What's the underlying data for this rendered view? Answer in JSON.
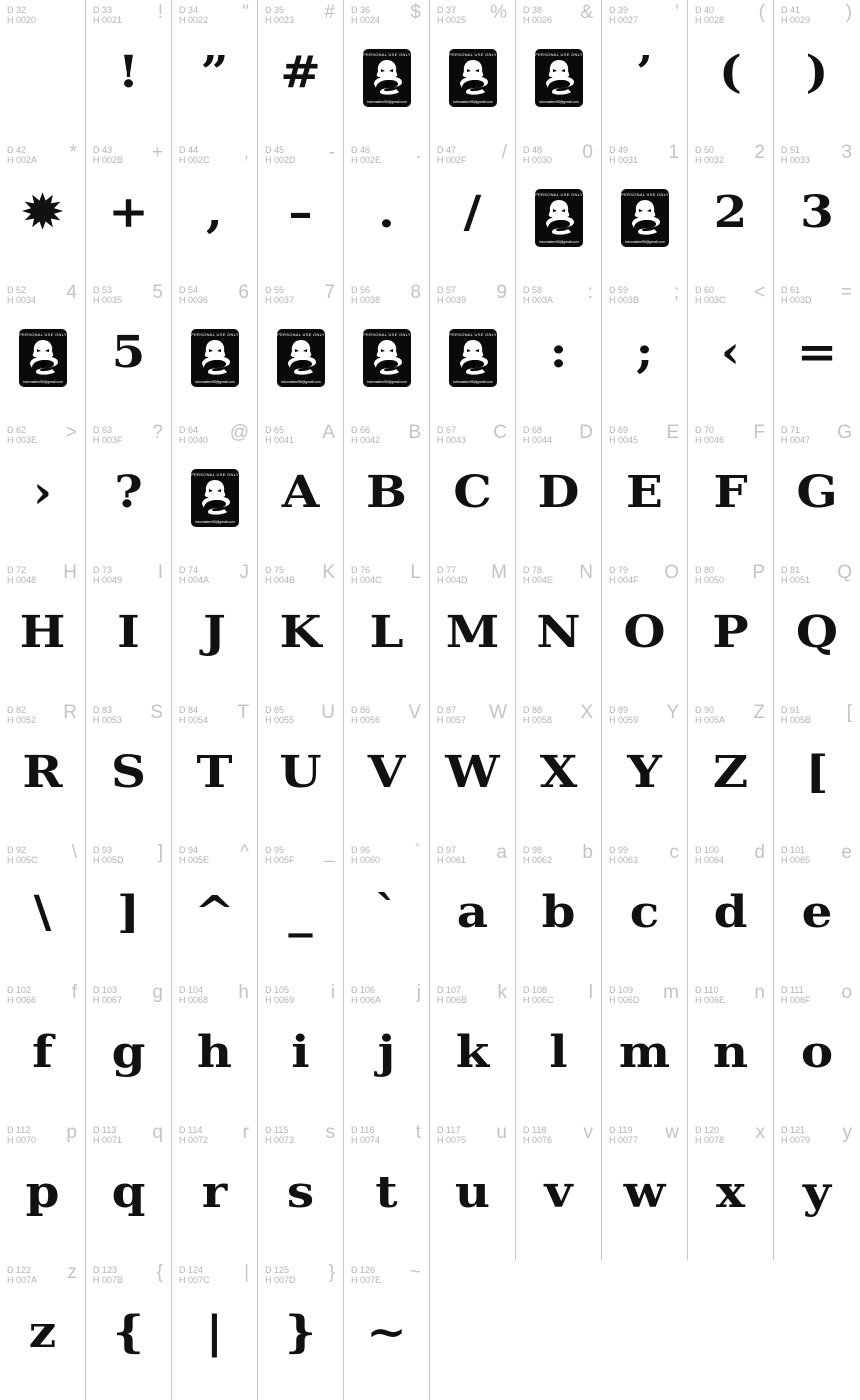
{
  "columns": 10,
  "logo": {
    "top_text": "PERSONAL USE ONLY",
    "bottom_text": "totomaiden98@gmail.com"
  },
  "cells": [
    {
      "d": "D 32",
      "h": "H 0020",
      "ref": "",
      "glyph": "",
      "logo": false
    },
    {
      "d": "D 33",
      "h": "H 0021",
      "ref": "!",
      "glyph": "!",
      "logo": false
    },
    {
      "d": "D 34",
      "h": "H 0022",
      "ref": "\"",
      "glyph": "”",
      "logo": false
    },
    {
      "d": "D 35",
      "h": "H 0023",
      "ref": "#",
      "glyph": "#",
      "logo": false
    },
    {
      "d": "D 36",
      "h": "H 0024",
      "ref": "$",
      "glyph": "",
      "logo": true
    },
    {
      "d": "D 37",
      "h": "H 0025",
      "ref": "%",
      "glyph": "",
      "logo": true
    },
    {
      "d": "D 38",
      "h": "H 0026",
      "ref": "&",
      "glyph": "",
      "logo": true
    },
    {
      "d": "D 39",
      "h": "H 0027",
      "ref": "'",
      "glyph": "’",
      "logo": false
    },
    {
      "d": "D 40",
      "h": "H 0028",
      "ref": "(",
      "glyph": "(",
      "logo": false
    },
    {
      "d": "D 41",
      "h": "H 0029",
      "ref": ")",
      "glyph": ")",
      "logo": false
    },
    {
      "d": "D 42",
      "h": "H 002A",
      "ref": "*",
      "glyph": "✹",
      "logo": false
    },
    {
      "d": "D 43",
      "h": "H 002B",
      "ref": "+",
      "glyph": "+",
      "logo": false
    },
    {
      "d": "D 44",
      "h": "H 002C",
      "ref": ",",
      "glyph": ",",
      "logo": false
    },
    {
      "d": "D 45",
      "h": "H 002D",
      "ref": "-",
      "glyph": "–",
      "logo": false
    },
    {
      "d": "D 46",
      "h": "H 002E",
      "ref": ".",
      "glyph": ".",
      "logo": false
    },
    {
      "d": "D 47",
      "h": "H 002F",
      "ref": "/",
      "glyph": "/",
      "logo": false
    },
    {
      "d": "D 48",
      "h": "H 0030",
      "ref": "0",
      "glyph": "",
      "logo": true
    },
    {
      "d": "D 49",
      "h": "H 0031",
      "ref": "1",
      "glyph": "",
      "logo": true
    },
    {
      "d": "D 50",
      "h": "H 0032",
      "ref": "2",
      "glyph": "2",
      "logo": false
    },
    {
      "d": "D 51",
      "h": "H 0033",
      "ref": "3",
      "glyph": "3",
      "logo": false
    },
    {
      "d": "D 52",
      "h": "H 0034",
      "ref": "4",
      "glyph": "",
      "logo": true
    },
    {
      "d": "D 53",
      "h": "H 0035",
      "ref": "5",
      "glyph": "5",
      "logo": false
    },
    {
      "d": "D 54",
      "h": "H 0036",
      "ref": "6",
      "glyph": "",
      "logo": true
    },
    {
      "d": "D 55",
      "h": "H 0037",
      "ref": "7",
      "glyph": "",
      "logo": true
    },
    {
      "d": "D 56",
      "h": "H 0038",
      "ref": "8",
      "glyph": "",
      "logo": true
    },
    {
      "d": "D 57",
      "h": "H 0039",
      "ref": "9",
      "glyph": "",
      "logo": true
    },
    {
      "d": "D 58",
      "h": "H 003A",
      "ref": ":",
      "glyph": ":",
      "logo": false
    },
    {
      "d": "D 59",
      "h": "H 003B",
      "ref": ";",
      "glyph": ";",
      "logo": false
    },
    {
      "d": "D 60",
      "h": "H 003C",
      "ref": "<",
      "glyph": "‹",
      "logo": false
    },
    {
      "d": "D 61",
      "h": "H 003D",
      "ref": "=",
      "glyph": "=",
      "logo": false
    },
    {
      "d": "D 62",
      "h": "H 003E",
      "ref": ">",
      "glyph": "›",
      "logo": false
    },
    {
      "d": "D 63",
      "h": "H 003F",
      "ref": "?",
      "glyph": "?",
      "logo": false
    },
    {
      "d": "D 64",
      "h": "H 0040",
      "ref": "@",
      "glyph": "",
      "logo": true
    },
    {
      "d": "D 65",
      "h": "H 0041",
      "ref": "A",
      "glyph": "A",
      "logo": false
    },
    {
      "d": "D 66",
      "h": "H 0042",
      "ref": "B",
      "glyph": "B",
      "logo": false
    },
    {
      "d": "D 67",
      "h": "H 0043",
      "ref": "C",
      "glyph": "C",
      "logo": false
    },
    {
      "d": "D 68",
      "h": "H 0044",
      "ref": "D",
      "glyph": "D",
      "logo": false
    },
    {
      "d": "D 69",
      "h": "H 0045",
      "ref": "E",
      "glyph": "E",
      "logo": false
    },
    {
      "d": "D 70",
      "h": "H 0046",
      "ref": "F",
      "glyph": "F",
      "logo": false
    },
    {
      "d": "D 71",
      "h": "H 0047",
      "ref": "G",
      "glyph": "G",
      "logo": false
    },
    {
      "d": "D 72",
      "h": "H 0048",
      "ref": "H",
      "glyph": "H",
      "logo": false
    },
    {
      "d": "D 73",
      "h": "H 0049",
      "ref": "I",
      "glyph": "I",
      "logo": false
    },
    {
      "d": "D 74",
      "h": "H 004A",
      "ref": "J",
      "glyph": "J",
      "logo": false
    },
    {
      "d": "D 75",
      "h": "H 004B",
      "ref": "K",
      "glyph": "K",
      "logo": false
    },
    {
      "d": "D 76",
      "h": "H 004C",
      "ref": "L",
      "glyph": "L",
      "logo": false
    },
    {
      "d": "D 77",
      "h": "H 004D",
      "ref": "M",
      "glyph": "M",
      "logo": false
    },
    {
      "d": "D 78",
      "h": "H 004E",
      "ref": "N",
      "glyph": "N",
      "logo": false
    },
    {
      "d": "D 79",
      "h": "H 004F",
      "ref": "O",
      "glyph": "O",
      "logo": false
    },
    {
      "d": "D 80",
      "h": "H 0050",
      "ref": "P",
      "glyph": "P",
      "logo": false
    },
    {
      "d": "D 81",
      "h": "H 0051",
      "ref": "Q",
      "glyph": "Q",
      "logo": false
    },
    {
      "d": "D 82",
      "h": "H 0052",
      "ref": "R",
      "glyph": "R",
      "logo": false
    },
    {
      "d": "D 83",
      "h": "H 0053",
      "ref": "S",
      "glyph": "S",
      "logo": false
    },
    {
      "d": "D 84",
      "h": "H 0054",
      "ref": "T",
      "glyph": "T",
      "logo": false
    },
    {
      "d": "D 85",
      "h": "H 0055",
      "ref": "U",
      "glyph": "U",
      "logo": false
    },
    {
      "d": "D 86",
      "h": "H 0056",
      "ref": "V",
      "glyph": "V",
      "logo": false
    },
    {
      "d": "D 87",
      "h": "H 0057",
      "ref": "W",
      "glyph": "W",
      "logo": false
    },
    {
      "d": "D 88",
      "h": "H 0058",
      "ref": "X",
      "glyph": "X",
      "logo": false
    },
    {
      "d": "D 89",
      "h": "H 0059",
      "ref": "Y",
      "glyph": "Y",
      "logo": false
    },
    {
      "d": "D 90",
      "h": "H 005A",
      "ref": "Z",
      "glyph": "Z",
      "logo": false
    },
    {
      "d": "D 91",
      "h": "H 005B",
      "ref": "[",
      "glyph": "[",
      "logo": false
    },
    {
      "d": "D 92",
      "h": "H 005C",
      "ref": "\\",
      "glyph": "\\",
      "logo": false
    },
    {
      "d": "D 93",
      "h": "H 005D",
      "ref": "]",
      "glyph": "]",
      "logo": false
    },
    {
      "d": "D 94",
      "h": "H 005E",
      "ref": "^",
      "glyph": "^",
      "logo": false
    },
    {
      "d": "D 95",
      "h": "H 005F",
      "ref": "_",
      "glyph": "_",
      "logo": false
    },
    {
      "d": "D 96",
      "h": "H 0060",
      "ref": "`",
      "glyph": "`",
      "logo": false
    },
    {
      "d": "D 97",
      "h": "H 0061",
      "ref": "a",
      "glyph": "a",
      "logo": false
    },
    {
      "d": "D 98",
      "h": "H 0062",
      "ref": "b",
      "glyph": "b",
      "logo": false
    },
    {
      "d": "D 99",
      "h": "H 0063",
      "ref": "c",
      "glyph": "c",
      "logo": false
    },
    {
      "d": "D 100",
      "h": "H 0064",
      "ref": "d",
      "glyph": "d",
      "logo": false
    },
    {
      "d": "D 101",
      "h": "H 0065",
      "ref": "e",
      "glyph": "e",
      "logo": false
    },
    {
      "d": "D 102",
      "h": "H 0066",
      "ref": "f",
      "glyph": "f",
      "logo": false
    },
    {
      "d": "D 103",
      "h": "H 0067",
      "ref": "g",
      "glyph": "g",
      "logo": false
    },
    {
      "d": "D 104",
      "h": "H 0068",
      "ref": "h",
      "glyph": "h",
      "logo": false
    },
    {
      "d": "D 105",
      "h": "H 0069",
      "ref": "i",
      "glyph": "i",
      "logo": false
    },
    {
      "d": "D 106",
      "h": "H 006A",
      "ref": "j",
      "glyph": "j",
      "logo": false
    },
    {
      "d": "D 107",
      "h": "H 006B",
      "ref": "k",
      "glyph": "k",
      "logo": false
    },
    {
      "d": "D 108",
      "h": "H 006C",
      "ref": "l",
      "glyph": "l",
      "logo": false
    },
    {
      "d": "D 109",
      "h": "H 006D",
      "ref": "m",
      "glyph": "m",
      "logo": false
    },
    {
      "d": "D 110",
      "h": "H 006E",
      "ref": "n",
      "glyph": "n",
      "logo": false
    },
    {
      "d": "D 111",
      "h": "H 006F",
      "ref": "o",
      "glyph": "o",
      "logo": false
    },
    {
      "d": "D 112",
      "h": "H 0070",
      "ref": "p",
      "glyph": "p",
      "logo": false
    },
    {
      "d": "D 113",
      "h": "H 0071",
      "ref": "q",
      "glyph": "q",
      "logo": false
    },
    {
      "d": "D 114",
      "h": "H 0072",
      "ref": "r",
      "glyph": "r",
      "logo": false
    },
    {
      "d": "D 115",
      "h": "H 0073",
      "ref": "s",
      "glyph": "s",
      "logo": false
    },
    {
      "d": "D 116",
      "h": "H 0074",
      "ref": "t",
      "glyph": "t",
      "logo": false
    },
    {
      "d": "D 117",
      "h": "H 0075",
      "ref": "u",
      "glyph": "u",
      "logo": false
    },
    {
      "d": "D 118",
      "h": "H 0076",
      "ref": "v",
      "glyph": "v",
      "logo": false
    },
    {
      "d": "D 119",
      "h": "H 0077",
      "ref": "w",
      "glyph": "w",
      "logo": false
    },
    {
      "d": "D 120",
      "h": "H 0078",
      "ref": "x",
      "glyph": "x",
      "logo": false
    },
    {
      "d": "D 121",
      "h": "H 0079",
      "ref": "y",
      "glyph": "y",
      "logo": false
    },
    {
      "d": "D 122",
      "h": "H 007A",
      "ref": "z",
      "glyph": "z",
      "logo": false
    },
    {
      "d": "D 123",
      "h": "H 007B",
      "ref": "{",
      "glyph": "{",
      "logo": false
    },
    {
      "d": "D 124",
      "h": "H 007C",
      "ref": "|",
      "glyph": "|",
      "logo": false
    },
    {
      "d": "D 125",
      "h": "H 007D",
      "ref": "}",
      "glyph": "}",
      "logo": false
    },
    {
      "d": "D 126",
      "h": "H 007E",
      "ref": "~",
      "glyph": "~",
      "logo": false
    }
  ]
}
